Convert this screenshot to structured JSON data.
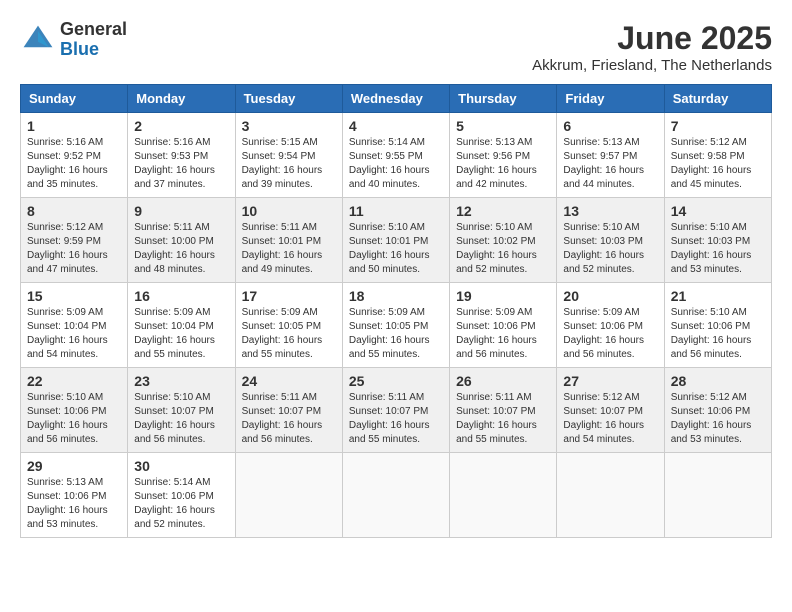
{
  "header": {
    "logo": {
      "general": "General",
      "blue": "Blue"
    },
    "month": "June 2025",
    "location": "Akkrum, Friesland, The Netherlands"
  },
  "weekdays": [
    "Sunday",
    "Monday",
    "Tuesday",
    "Wednesday",
    "Thursday",
    "Friday",
    "Saturday"
  ],
  "weeks": [
    [
      {
        "day": "1",
        "sunrise": "Sunrise: 5:16 AM",
        "sunset": "Sunset: 9:52 PM",
        "daylight": "Daylight: 16 hours and 35 minutes."
      },
      {
        "day": "2",
        "sunrise": "Sunrise: 5:16 AM",
        "sunset": "Sunset: 9:53 PM",
        "daylight": "Daylight: 16 hours and 37 minutes."
      },
      {
        "day": "3",
        "sunrise": "Sunrise: 5:15 AM",
        "sunset": "Sunset: 9:54 PM",
        "daylight": "Daylight: 16 hours and 39 minutes."
      },
      {
        "day": "4",
        "sunrise": "Sunrise: 5:14 AM",
        "sunset": "Sunset: 9:55 PM",
        "daylight": "Daylight: 16 hours and 40 minutes."
      },
      {
        "day": "5",
        "sunrise": "Sunrise: 5:13 AM",
        "sunset": "Sunset: 9:56 PM",
        "daylight": "Daylight: 16 hours and 42 minutes."
      },
      {
        "day": "6",
        "sunrise": "Sunrise: 5:13 AM",
        "sunset": "Sunset: 9:57 PM",
        "daylight": "Daylight: 16 hours and 44 minutes."
      },
      {
        "day": "7",
        "sunrise": "Sunrise: 5:12 AM",
        "sunset": "Sunset: 9:58 PM",
        "daylight": "Daylight: 16 hours and 45 minutes."
      }
    ],
    [
      {
        "day": "8",
        "sunrise": "Sunrise: 5:12 AM",
        "sunset": "Sunset: 9:59 PM",
        "daylight": "Daylight: 16 hours and 47 minutes."
      },
      {
        "day": "9",
        "sunrise": "Sunrise: 5:11 AM",
        "sunset": "Sunset: 10:00 PM",
        "daylight": "Daylight: 16 hours and 48 minutes."
      },
      {
        "day": "10",
        "sunrise": "Sunrise: 5:11 AM",
        "sunset": "Sunset: 10:01 PM",
        "daylight": "Daylight: 16 hours and 49 minutes."
      },
      {
        "day": "11",
        "sunrise": "Sunrise: 5:10 AM",
        "sunset": "Sunset: 10:01 PM",
        "daylight": "Daylight: 16 hours and 50 minutes."
      },
      {
        "day": "12",
        "sunrise": "Sunrise: 5:10 AM",
        "sunset": "Sunset: 10:02 PM",
        "daylight": "Daylight: 16 hours and 52 minutes."
      },
      {
        "day": "13",
        "sunrise": "Sunrise: 5:10 AM",
        "sunset": "Sunset: 10:03 PM",
        "daylight": "Daylight: 16 hours and 52 minutes."
      },
      {
        "day": "14",
        "sunrise": "Sunrise: 5:10 AM",
        "sunset": "Sunset: 10:03 PM",
        "daylight": "Daylight: 16 hours and 53 minutes."
      }
    ],
    [
      {
        "day": "15",
        "sunrise": "Sunrise: 5:09 AM",
        "sunset": "Sunset: 10:04 PM",
        "daylight": "Daylight: 16 hours and 54 minutes."
      },
      {
        "day": "16",
        "sunrise": "Sunrise: 5:09 AM",
        "sunset": "Sunset: 10:04 PM",
        "daylight": "Daylight: 16 hours and 55 minutes."
      },
      {
        "day": "17",
        "sunrise": "Sunrise: 5:09 AM",
        "sunset": "Sunset: 10:05 PM",
        "daylight": "Daylight: 16 hours and 55 minutes."
      },
      {
        "day": "18",
        "sunrise": "Sunrise: 5:09 AM",
        "sunset": "Sunset: 10:05 PM",
        "daylight": "Daylight: 16 hours and 55 minutes."
      },
      {
        "day": "19",
        "sunrise": "Sunrise: 5:09 AM",
        "sunset": "Sunset: 10:06 PM",
        "daylight": "Daylight: 16 hours and 56 minutes."
      },
      {
        "day": "20",
        "sunrise": "Sunrise: 5:09 AM",
        "sunset": "Sunset: 10:06 PM",
        "daylight": "Daylight: 16 hours and 56 minutes."
      },
      {
        "day": "21",
        "sunrise": "Sunrise: 5:10 AM",
        "sunset": "Sunset: 10:06 PM",
        "daylight": "Daylight: 16 hours and 56 minutes."
      }
    ],
    [
      {
        "day": "22",
        "sunrise": "Sunrise: 5:10 AM",
        "sunset": "Sunset: 10:06 PM",
        "daylight": "Daylight: 16 hours and 56 minutes."
      },
      {
        "day": "23",
        "sunrise": "Sunrise: 5:10 AM",
        "sunset": "Sunset: 10:07 PM",
        "daylight": "Daylight: 16 hours and 56 minutes."
      },
      {
        "day": "24",
        "sunrise": "Sunrise: 5:11 AM",
        "sunset": "Sunset: 10:07 PM",
        "daylight": "Daylight: 16 hours and 56 minutes."
      },
      {
        "day": "25",
        "sunrise": "Sunrise: 5:11 AM",
        "sunset": "Sunset: 10:07 PM",
        "daylight": "Daylight: 16 hours and 55 minutes."
      },
      {
        "day": "26",
        "sunrise": "Sunrise: 5:11 AM",
        "sunset": "Sunset: 10:07 PM",
        "daylight": "Daylight: 16 hours and 55 minutes."
      },
      {
        "day": "27",
        "sunrise": "Sunrise: 5:12 AM",
        "sunset": "Sunset: 10:07 PM",
        "daylight": "Daylight: 16 hours and 54 minutes."
      },
      {
        "day": "28",
        "sunrise": "Sunrise: 5:12 AM",
        "sunset": "Sunset: 10:06 PM",
        "daylight": "Daylight: 16 hours and 53 minutes."
      }
    ],
    [
      {
        "day": "29",
        "sunrise": "Sunrise: 5:13 AM",
        "sunset": "Sunset: 10:06 PM",
        "daylight": "Daylight: 16 hours and 53 minutes."
      },
      {
        "day": "30",
        "sunrise": "Sunrise: 5:14 AM",
        "sunset": "Sunset: 10:06 PM",
        "daylight": "Daylight: 16 hours and 52 minutes."
      },
      null,
      null,
      null,
      null,
      null
    ]
  ]
}
